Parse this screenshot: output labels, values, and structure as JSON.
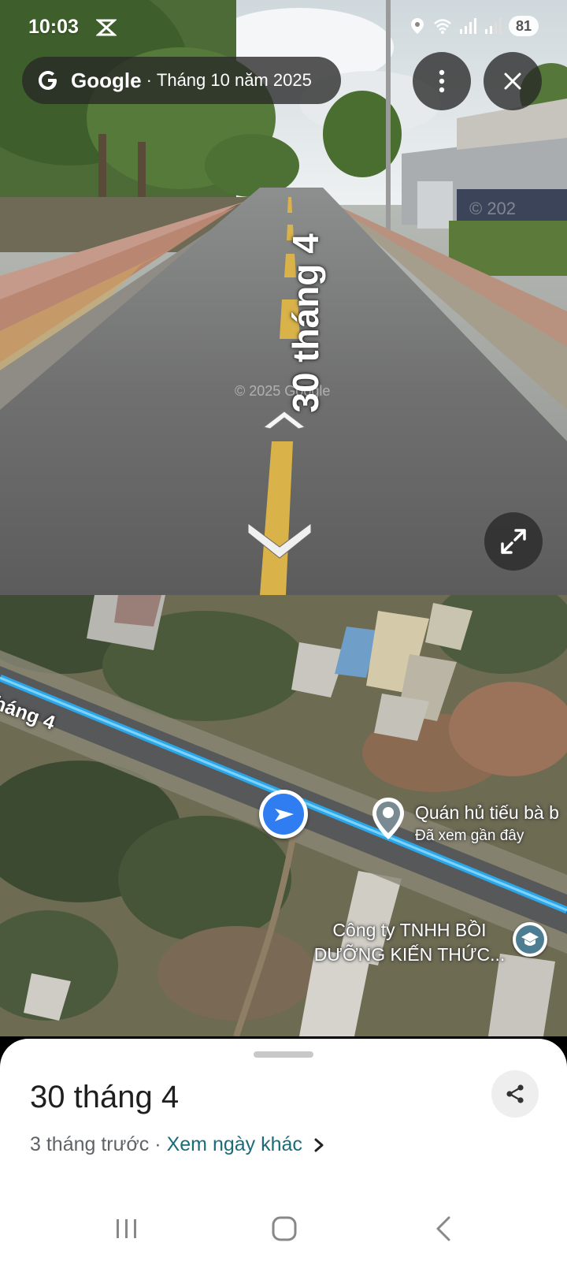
{
  "status_bar": {
    "time": "10:03",
    "battery": "81"
  },
  "source": {
    "brand": "Google",
    "separator": "·",
    "date": "Tháng 10 năm 2025"
  },
  "street_view": {
    "road_label": "30 tháng 4",
    "copyright": "© 2025 Google",
    "watermark": "© 202"
  },
  "map": {
    "road_label": "tháng 4",
    "poi": {
      "name": "Quán hủ tiếu bà b",
      "subtitle": "Đã xem gần đây"
    },
    "company": {
      "line1": "Công ty TNHH BỒI",
      "line2": "DƯỠNG KIẾN THỨC..."
    }
  },
  "sheet": {
    "title": "30 tháng 4",
    "age": "3 tháng trước",
    "separator": "·",
    "other_dates_link": "Xem ngày khác"
  },
  "colors": {
    "route_blue": "#2aa7ea",
    "location_blue": "#2f7df0",
    "link_teal": "#1a6d78"
  },
  "icons": [
    "app-notification-icon",
    "location-icon",
    "wifi-icon",
    "signal-icon",
    "google-g-icon",
    "more-vert-icon",
    "close-icon",
    "expand-icon",
    "navigation-arrow-icon",
    "map-pin-icon",
    "school-icon",
    "share-icon",
    "chevron-right-icon",
    "recents-icon",
    "home-icon",
    "back-icon"
  ]
}
